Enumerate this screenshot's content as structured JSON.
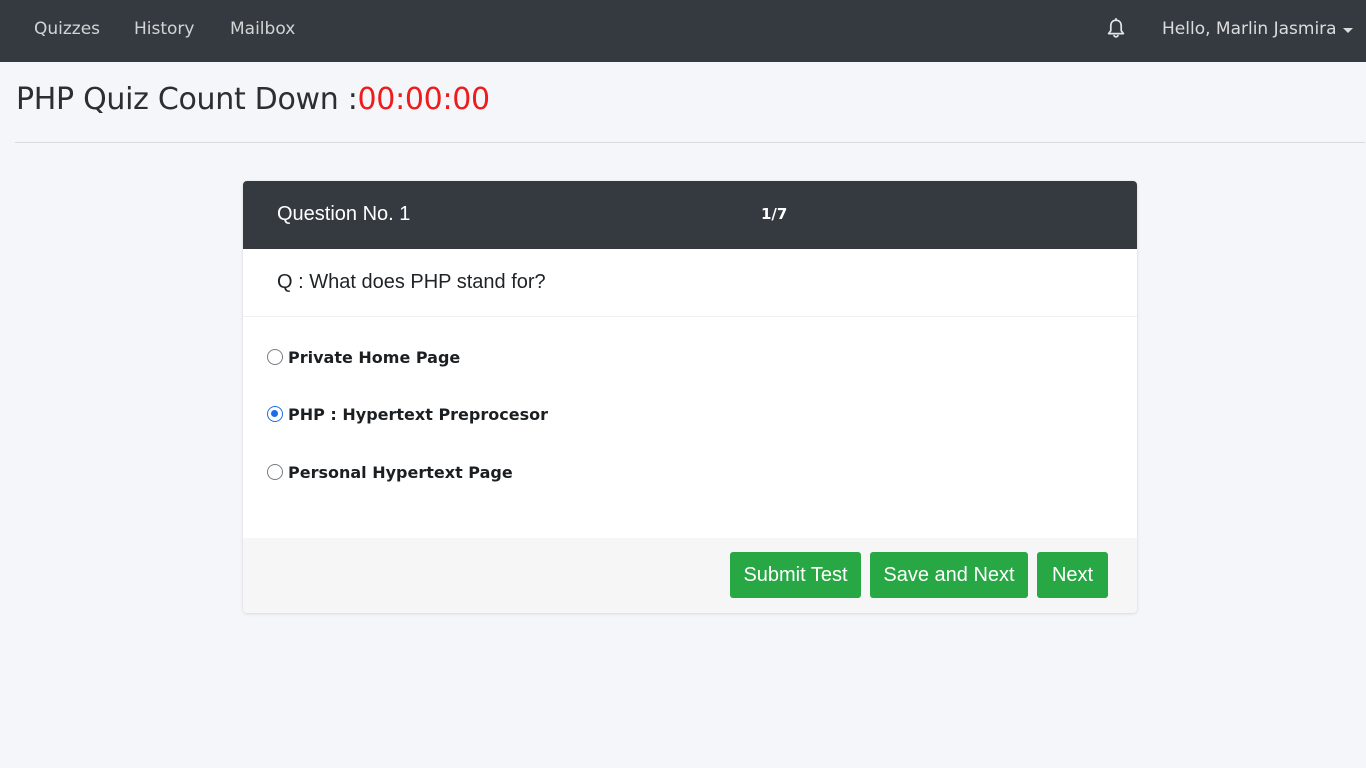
{
  "navbar": {
    "links": [
      "Quizzes",
      "History",
      "Mailbox"
    ],
    "notification_icon": "bell-icon",
    "user_greeting": "Hello, Marlin Jasmira"
  },
  "heading": {
    "title": "PHP Quiz Count Down :",
    "countdown": "00:00:00"
  },
  "quiz": {
    "question_number": "Question No. 1",
    "progress": "1/7",
    "question": "Q : What does PHP stand for?",
    "options": [
      {
        "label": "Private Home Page",
        "selected": false
      },
      {
        "label": "PHP : Hypertext Preprocesor",
        "selected": true
      },
      {
        "label": "Personal Hypertext Page",
        "selected": false
      }
    ],
    "buttons": {
      "submit": "Submit Test",
      "save_next": "Save and Next",
      "next": "Next"
    }
  },
  "colors": {
    "navbar_bg": "#343a40",
    "countdown": "#ee1c1c",
    "button_green": "#28a745",
    "radio_selected": "#1a6ee8"
  }
}
